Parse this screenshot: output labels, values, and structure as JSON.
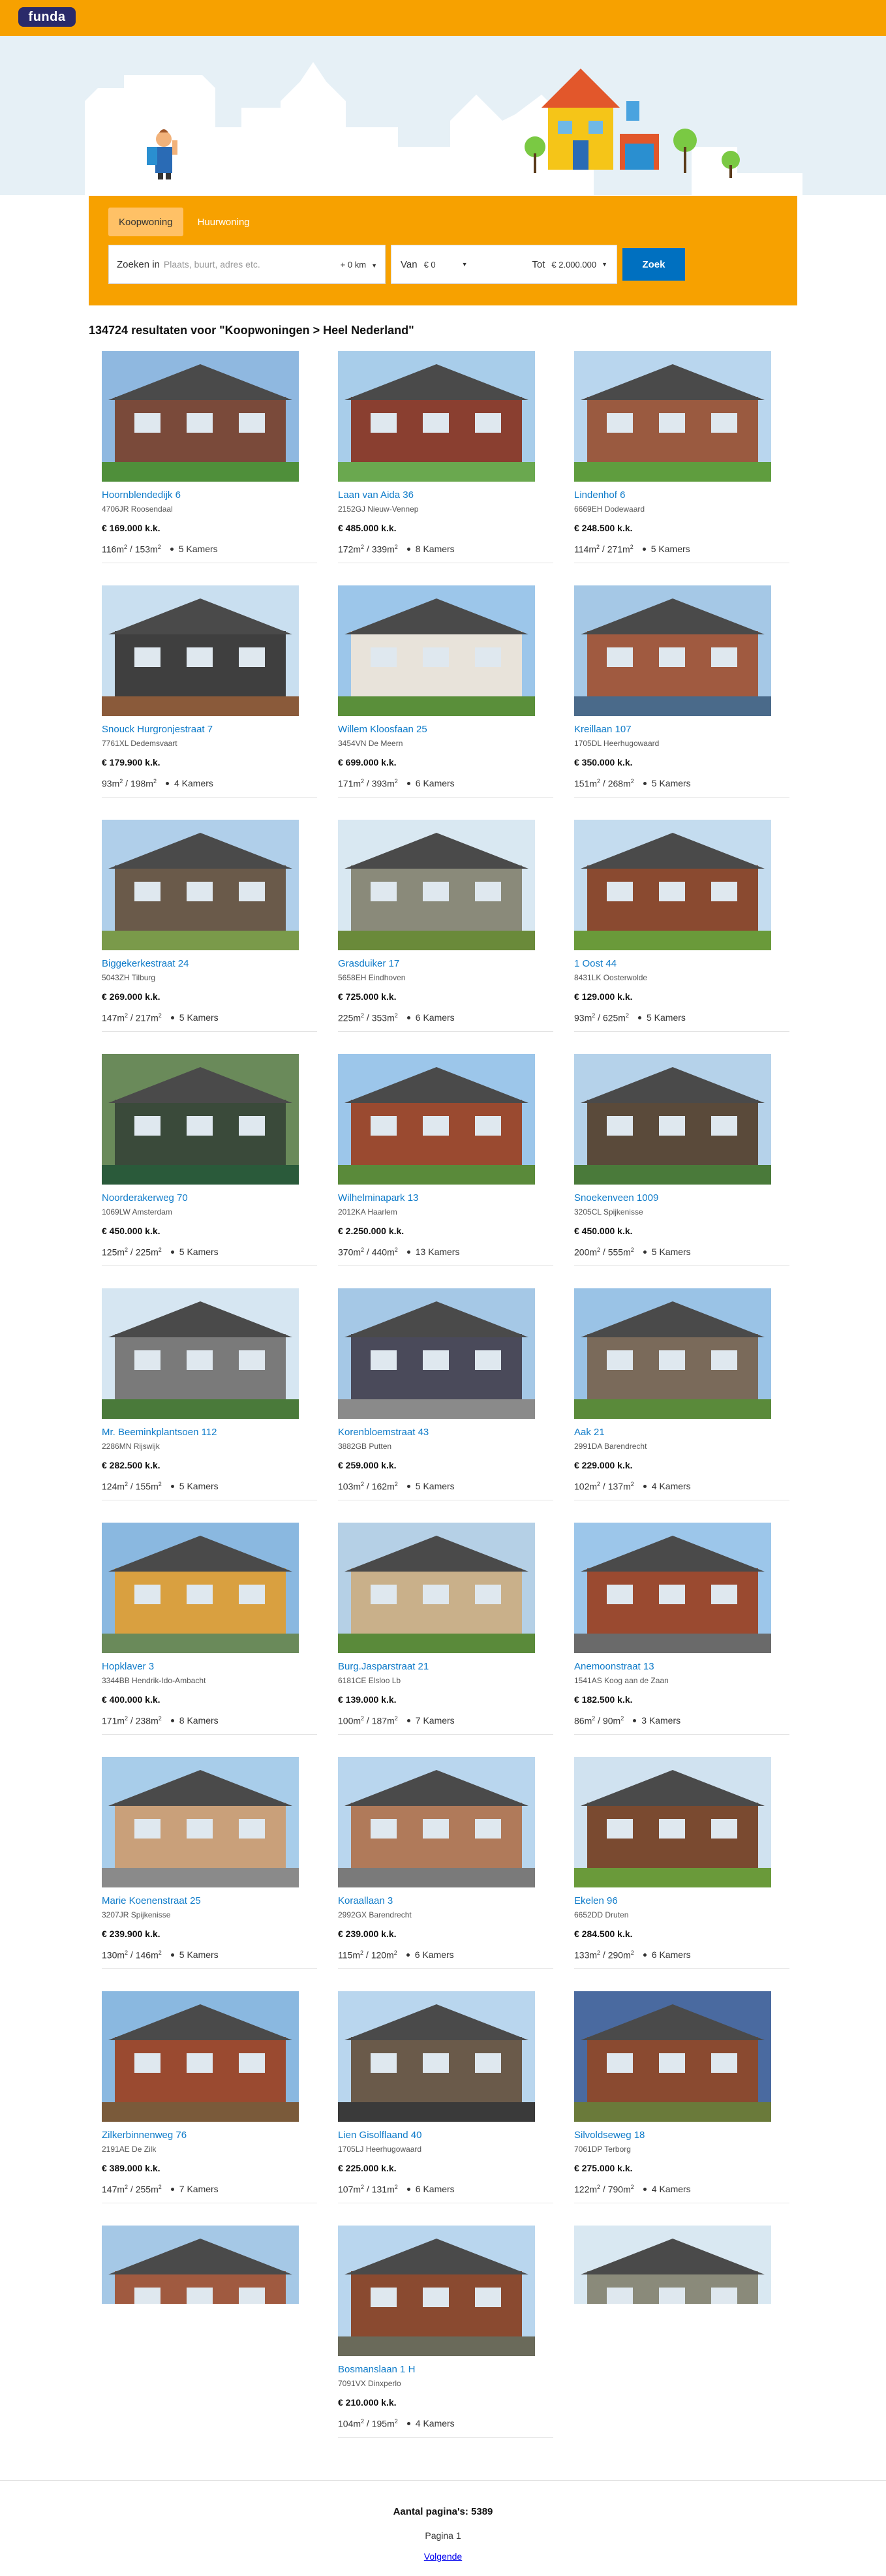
{
  "header": {
    "logo_text": "funda",
    "brand_color": "#f7a100"
  },
  "search": {
    "tabs": [
      {
        "label": "Koopwoning",
        "active": true
      },
      {
        "label": "Huurwoning",
        "active": false
      }
    ],
    "where_label": "Zoeken in",
    "where_placeholder": "Plaats, buurt, adres etc.",
    "radius": "+ 0 km",
    "from_label": "Van",
    "from_value": "€ 0",
    "to_label": "Tot",
    "to_value": "€ 2.000.000",
    "submit_label": "Zoek"
  },
  "results_title": "134724 resultaten voor \"Koopwoningen > Heel Nederland\"",
  "listings": [
    {
      "street": "Hoornblendedijk 6",
      "zip": "4706JR Roosendaal",
      "price": "€ 169.000 k.k.",
      "living": "116",
      "plot": "153",
      "rooms": "5 Kamers"
    },
    {
      "street": "Laan van Aida 36",
      "zip": "2152GJ Nieuw-Vennep",
      "price": "€ 485.000 k.k.",
      "living": "172",
      "plot": "339",
      "rooms": "8 Kamers"
    },
    {
      "street": "Lindenhof 6",
      "zip": "6669EH Dodewaard",
      "price": "€ 248.500 k.k.",
      "living": "114",
      "plot": "271",
      "rooms": "5 Kamers"
    },
    {
      "street": "Snouck Hurgronjestraat 7",
      "zip": "7761XL Dedemsvaart",
      "price": "€ 179.900 k.k.",
      "living": "93",
      "plot": "198",
      "rooms": "4 Kamers"
    },
    {
      "street": "Willem Kloosfaan 25",
      "zip": "3454VN De Meern",
      "price": "€ 699.000 k.k.",
      "living": "171",
      "plot": "393",
      "rooms": "6 Kamers"
    },
    {
      "street": "Kreillaan 107",
      "zip": "1705DL Heerhugowaard",
      "price": "€ 350.000 k.k.",
      "living": "151",
      "plot": "268",
      "rooms": "5 Kamers"
    },
    {
      "street": "Biggekerkestraat 24",
      "zip": "5043ZH Tilburg",
      "price": "€ 269.000 k.k.",
      "living": "147",
      "plot": "217",
      "rooms": "5 Kamers"
    },
    {
      "street": "Grasduiker 17",
      "zip": "5658EH Eindhoven",
      "price": "€ 725.000 k.k.",
      "living": "225",
      "plot": "353",
      "rooms": "6 Kamers"
    },
    {
      "street": "1 Oost 44",
      "zip": "8431LK Oosterwolde",
      "price": "€ 129.000 k.k.",
      "living": "93",
      "plot": "625",
      "rooms": "5 Kamers"
    },
    {
      "street": "Noorderakerweg 70",
      "zip": "1069LW Amsterdam",
      "price": "€ 450.000 k.k.",
      "living": "125",
      "plot": "225",
      "rooms": "5 Kamers"
    },
    {
      "street": "Wilhelminapark 13",
      "zip": "2012KA Haarlem",
      "price": "€ 2.250.000 k.k.",
      "living": "370",
      "plot": "440",
      "rooms": "13 Kamers"
    },
    {
      "street": "Snoekenveen 1009",
      "zip": "3205CL Spijkenisse",
      "price": "€ 450.000 k.k.",
      "living": "200",
      "plot": "555",
      "rooms": "5 Kamers"
    },
    {
      "street": "Mr. Beeminkplantsoen 112",
      "zip": "2286MN Rijswijk",
      "price": "€ 282.500 k.k.",
      "living": "124",
      "plot": "155",
      "rooms": "5 Kamers"
    },
    {
      "street": "Korenbloemstraat 43",
      "zip": "3882GB Putten",
      "price": "€ 259.000 k.k.",
      "living": "103",
      "plot": "162",
      "rooms": "5 Kamers"
    },
    {
      "street": "Aak 21",
      "zip": "2991DA Barendrecht",
      "price": "€ 229.000 k.k.",
      "living": "102",
      "plot": "137",
      "rooms": "4 Kamers"
    },
    {
      "street": "Hopklaver 3",
      "zip": "3344BB Hendrik-Ido-Ambacht",
      "price": "€ 400.000 k.k.",
      "living": "171",
      "plot": "238",
      "rooms": "8 Kamers"
    },
    {
      "street": "Burg.Jasparstraat 21",
      "zip": "6181CE Elsloo Lb",
      "price": "€ 139.000 k.k.",
      "living": "100",
      "plot": "187",
      "rooms": "7 Kamers"
    },
    {
      "street": "Anemoonstraat 13",
      "zip": "1541AS Koog aan de Zaan",
      "price": "€ 182.500 k.k.",
      "living": "86",
      "plot": "90",
      "rooms": "3 Kamers"
    },
    {
      "street": "Marie Koenenstraat 25",
      "zip": "3207JR Spijkenisse",
      "price": "€ 239.900 k.k.",
      "living": "130",
      "plot": "146",
      "rooms": "5 Kamers"
    },
    {
      "street": "Koraallaan 3",
      "zip": "2992GX Barendrecht",
      "price": "€ 239.000 k.k.",
      "living": "115",
      "plot": "120",
      "rooms": "6 Kamers"
    },
    {
      "street": "Ekelen 96",
      "zip": "6652DD Druten",
      "price": "€ 284.500 k.k.",
      "living": "133",
      "plot": "290",
      "rooms": "6 Kamers"
    },
    {
      "street": "Zilkerbinnenweg 76",
      "zip": "2191AE De Zilk",
      "price": "€ 389.000 k.k.",
      "living": "147",
      "plot": "255",
      "rooms": "7 Kamers"
    },
    {
      "street": "Lien Gisolflaand 40",
      "zip": "1705LJ Heerhugowaard",
      "price": "€ 225.000 k.k.",
      "living": "107",
      "plot": "131",
      "rooms": "6 Kamers"
    },
    {
      "street": "Silvoldseweg 18",
      "zip": "7061DP Terborg",
      "price": "€ 275.000 k.k.",
      "living": "122",
      "plot": "790",
      "rooms": "4 Kamers"
    },
    {
      "street": "Bosmanslaan 1 H",
      "zip": "7091VX Dinxperlo",
      "price": "€ 210.000 k.k.",
      "living": "104",
      "plot": "195",
      "rooms": "4 Kamers"
    }
  ],
  "pagination": {
    "total": "Aantal pagina's: 5389",
    "current": "Pagina 1",
    "next": "Volgende"
  }
}
